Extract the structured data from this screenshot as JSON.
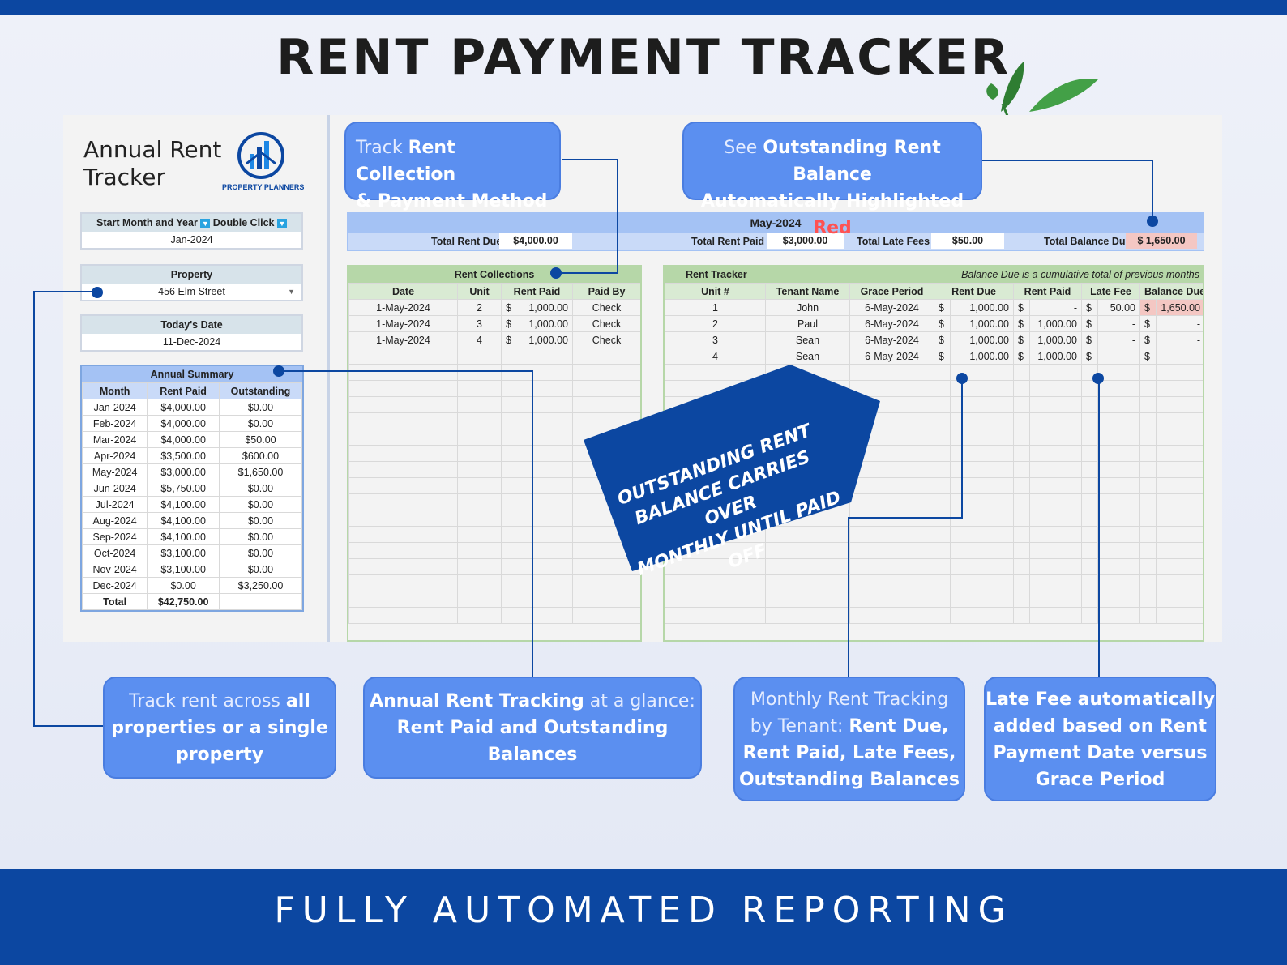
{
  "title": "RENT PAYMENT TRACKER",
  "footer": "FULLY AUTOMATED REPORTING",
  "sidebar": {
    "app_title_1": "Annual Rent",
    "app_title_2": "Tracker",
    "brand": "PROPERTY PLANNERS",
    "start_label": "Start Month and Year",
    "start_hint": "Double Click",
    "start_value": "Jan-2024",
    "property_label": "Property",
    "property_value": "456 Elm Street",
    "today_label": "Today's Date",
    "today_value": "11-Dec-2024",
    "summary": {
      "title": "Annual Summary",
      "headers": [
        "Month",
        "Rent Paid",
        "Outstanding"
      ],
      "rows": [
        [
          "Jan-2024",
          "$4,000.00",
          "$0.00"
        ],
        [
          "Feb-2024",
          "$4,000.00",
          "$0.00"
        ],
        [
          "Mar-2024",
          "$4,000.00",
          "$50.00"
        ],
        [
          "Apr-2024",
          "$3,500.00",
          "$600.00"
        ],
        [
          "May-2024",
          "$3,000.00",
          "$1,650.00"
        ],
        [
          "Jun-2024",
          "$5,750.00",
          "$0.00"
        ],
        [
          "Jul-2024",
          "$4,100.00",
          "$0.00"
        ],
        [
          "Aug-2024",
          "$4,100.00",
          "$0.00"
        ],
        [
          "Sep-2024",
          "$4,100.00",
          "$0.00"
        ],
        [
          "Oct-2024",
          "$3,100.00",
          "$0.00"
        ],
        [
          "Nov-2024",
          "$3,100.00",
          "$0.00"
        ],
        [
          "Dec-2024",
          "$0.00",
          "$3,250.00"
        ]
      ],
      "total_label": "Total",
      "total_value": "$42,750.00"
    }
  },
  "month_header": {
    "month": "May-2024",
    "total_rent_due_label": "Total Rent Due",
    "total_rent_due": "$4,000.00",
    "total_rent_paid_label": "Total Rent Paid",
    "total_rent_paid": "$3,000.00",
    "total_late_fees_label": "Total Late Fees",
    "total_late_fees": "$50.00",
    "total_balance_due_label": "Total Balance Due",
    "total_balance_due": "$ 1,650.00"
  },
  "collections": {
    "title": "Rent Collections",
    "headers": [
      "Date",
      "Unit",
      "Rent Paid",
      "Paid By"
    ],
    "rows": [
      [
        "1-May-2024",
        "2",
        "$",
        "1,000.00",
        "Check"
      ],
      [
        "1-May-2024",
        "3",
        "$",
        "1,000.00",
        "Check"
      ],
      [
        "1-May-2024",
        "4",
        "$",
        "1,000.00",
        "Check"
      ]
    ]
  },
  "tracker": {
    "title": "Rent Tracker",
    "note": "Balance Due is a cumulative total of previous months",
    "headers": [
      "Unit #",
      "Tenant Name",
      "Grace Period",
      "Rent Due",
      "Rent Paid",
      "Late Fee",
      "Balance Due"
    ],
    "rows": [
      [
        "1",
        "John",
        "6-May-2024",
        "$",
        "1,000.00",
        "$",
        "-",
        "$",
        "50.00",
        "$",
        "1,650.00"
      ],
      [
        "2",
        "Paul",
        "6-May-2024",
        "$",
        "1,000.00",
        "$",
        "1,000.00",
        "$",
        "-",
        "$",
        "-"
      ],
      [
        "3",
        "Sean",
        "6-May-2024",
        "$",
        "1,000.00",
        "$",
        "1,000.00",
        "$",
        "-",
        "$",
        "-"
      ],
      [
        "4",
        "Sean",
        "6-May-2024",
        "$",
        "1,000.00",
        "$",
        "1,000.00",
        "$",
        "-",
        "$",
        "-"
      ]
    ]
  },
  "banner": {
    "line1": "OUTSTANDING RENT",
    "line2": "BALANCE CARRIES OVER",
    "line3": "MONTHLY UNTIL PAID OFF"
  },
  "callouts": {
    "c1": {
      "a": "Track ",
      "b": "Rent Collection",
      "c": "& Payment Method"
    },
    "c2": {
      "a": "See ",
      "b": "Outstanding Rent Balance",
      "c": "Automatically Highlighted ",
      "d": "Red"
    },
    "c3": {
      "a": "Track rent across ",
      "b": "all",
      "c": "properties or a single",
      "d": "property"
    },
    "c4": {
      "a": "Annual Rent Tracking",
      "b": " at a glance:",
      "c": "Rent Paid and Outstanding",
      "d": "Balances"
    },
    "c5": {
      "a": "Monthly Rent Tracking",
      "b": "by Tenant: ",
      "c": "Rent Due,",
      "d": "Rent Paid, Late Fees,",
      "e": "Outstanding Balances"
    },
    "c6": {
      "a": "Late Fee automatically",
      "b": "added based on Rent",
      "c": "Payment Date versus",
      "d": "Grace Period"
    }
  },
  "colors": {
    "brand_blue": "#0c47a1",
    "callout_blue": "#5b8ff0",
    "highlight_red": "#f4c7c3",
    "sheet_green": "#d9ead3"
  }
}
